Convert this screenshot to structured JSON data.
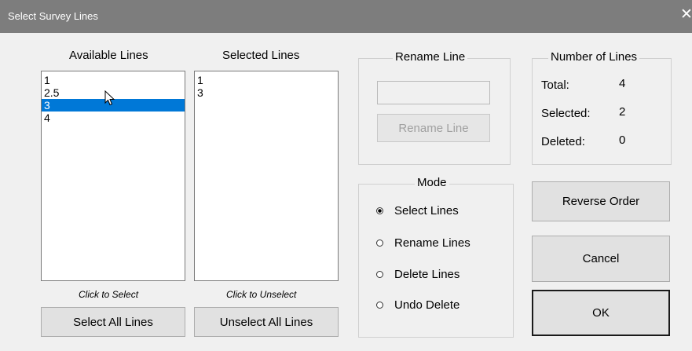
{
  "window": {
    "title": "Select Survey Lines",
    "close": "✕"
  },
  "available": {
    "heading": "Available Lines",
    "items": [
      "1",
      "2.5",
      "3",
      "4"
    ],
    "selected_item": "3",
    "hint": "Click to Select",
    "button": "Select All Lines"
  },
  "selected": {
    "heading": "Selected Lines",
    "items": [
      "1",
      "3"
    ],
    "hint": "Click to Unselect",
    "button": "Unselect All Lines"
  },
  "rename": {
    "title": "Rename Line",
    "input_value": "",
    "button": "Rename Line"
  },
  "counts": {
    "title": "Number of Lines",
    "total_label": "Total:",
    "total": "4",
    "selected_label": "Selected:",
    "selected": "2",
    "deleted_label": "Deleted:",
    "deleted": "0"
  },
  "mode": {
    "title": "Mode",
    "options": [
      "Select Lines",
      "Rename Lines",
      "Delete Lines",
      "Undo Delete"
    ],
    "selected": "Select Lines"
  },
  "buttons": {
    "reverse": "Reverse Order",
    "cancel": "Cancel",
    "ok": "OK"
  }
}
